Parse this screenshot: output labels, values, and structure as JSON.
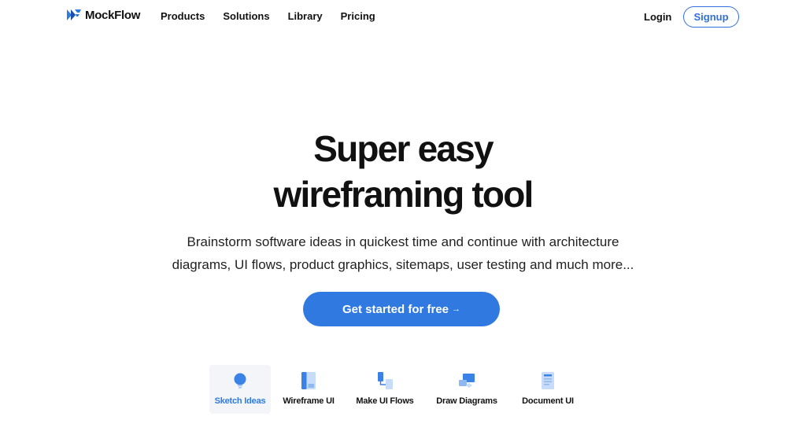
{
  "header": {
    "logo_text": "MockFlow",
    "nav": [
      {
        "label": "Products"
      },
      {
        "label": "Solutions"
      },
      {
        "label": "Library"
      },
      {
        "label": "Pricing"
      }
    ],
    "login_label": "Login",
    "signup_label": "Signup"
  },
  "hero": {
    "title_line1": "Super easy",
    "title_line2": "wireframing tool",
    "subtitle_line1": "Brainstorm software ideas in quickest time and continue with architecture",
    "subtitle_line2": "diagrams, UI flows, product graphics, sitemaps, user testing and much more...",
    "cta_label": "Get started for free",
    "cta_arrow": "→"
  },
  "tabs": [
    {
      "label": "Sketch Ideas",
      "icon": "lightbulb-icon",
      "active": true
    },
    {
      "label": "Wireframe UI",
      "icon": "wireframe-icon",
      "active": false
    },
    {
      "label": "Make UI Flows",
      "icon": "flow-icon",
      "active": false
    },
    {
      "label": "Draw Diagrams",
      "icon": "diagram-icon",
      "active": false
    },
    {
      "label": "Document UI",
      "icon": "document-icon",
      "active": false
    }
  ],
  "colors": {
    "accent": "#2f79e0",
    "text": "#111111",
    "active_tab_bg": "#f3f5f8"
  }
}
